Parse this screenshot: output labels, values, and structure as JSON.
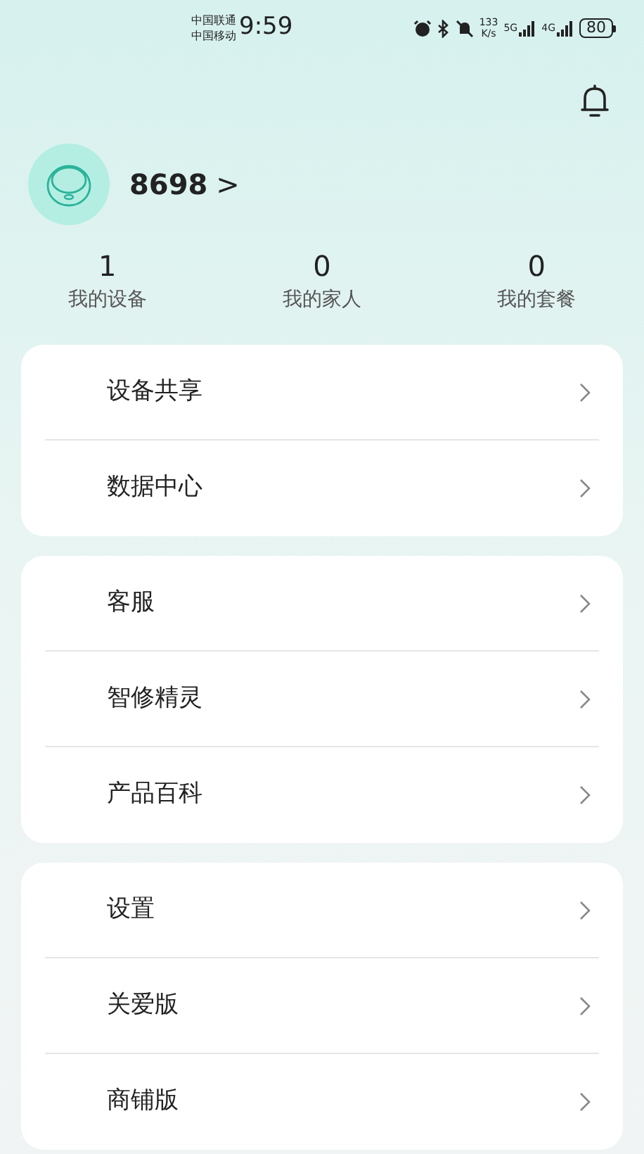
{
  "status_bar": {
    "carriers": [
      "中国联通",
      "中国移动"
    ],
    "time": "9:59",
    "speed": "133",
    "speed_unit": "K/s",
    "network_1": "5G",
    "network_2": "4G",
    "battery": "80"
  },
  "profile": {
    "name": "8698",
    "chevron": ">"
  },
  "stats": [
    {
      "value": "1",
      "label": "我的设备"
    },
    {
      "value": "0",
      "label": "我的家人"
    },
    {
      "value": "0",
      "label": "我的套餐"
    }
  ],
  "menu_groups": [
    [
      {
        "label": "设备共享"
      },
      {
        "label": "数据中心"
      }
    ],
    [
      {
        "label": "客服"
      },
      {
        "label": "智修精灵"
      },
      {
        "label": "产品百科"
      }
    ],
    [
      {
        "label": "设置"
      },
      {
        "label": "关爱版"
      },
      {
        "label": "商铺版"
      }
    ]
  ]
}
